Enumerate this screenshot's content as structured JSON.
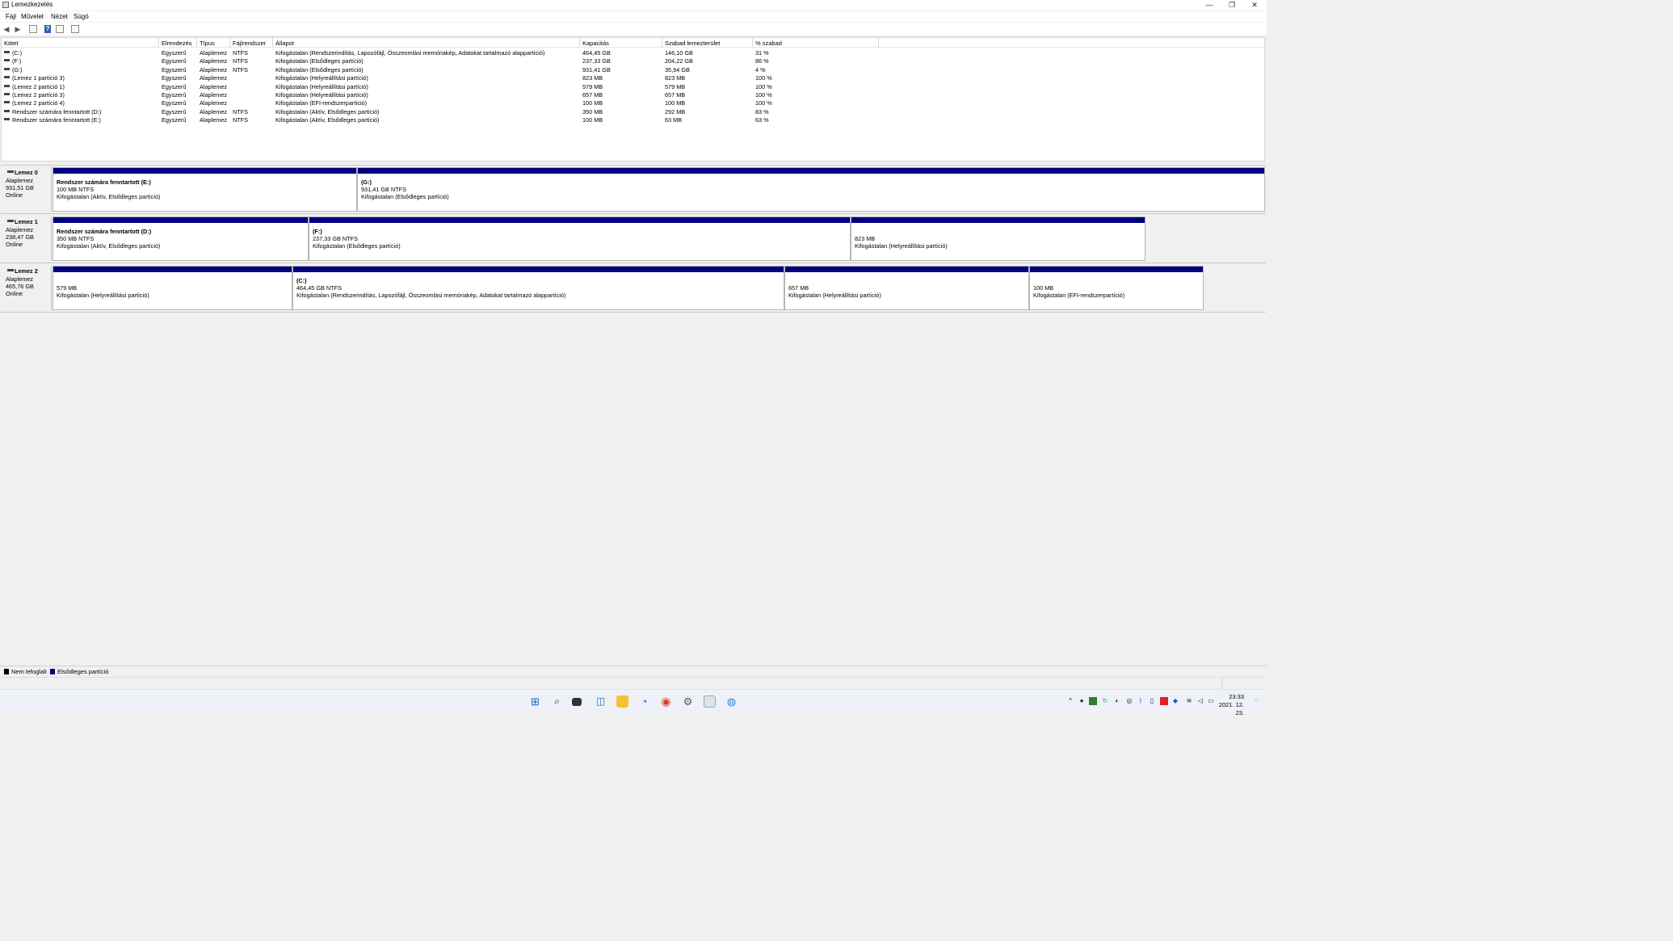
{
  "window": {
    "title": "Lemezkezelés",
    "controls": {
      "minimize": "—",
      "restore": "❐",
      "close": "✕"
    }
  },
  "menu": [
    "Fájl",
    "Művelet",
    "Nézet",
    "Súgó"
  ],
  "volume_table": {
    "headers": [
      "Kötet",
      "Elrendezés",
      "Típus",
      "Fájlrendszer",
      "Állapot",
      "Kapacitás",
      "Szabad lemezterület",
      "% szabad"
    ],
    "rows": [
      [
        "(C:)",
        "Egyszerű",
        "Alaplemez",
        "NTFS",
        "Kifogástalan (Rendszerindítás, Lapozófájl, Összeomlási memóriakép, Adatokat tartalmazó alappartíció)",
        "464,45 GB",
        "146,10 GB",
        "31 %"
      ],
      [
        "(F:)",
        "Egyszerű",
        "Alaplemez",
        "NTFS",
        "Kifogástalan (Elsődleges partíció)",
        "237,33 GB",
        "204,22 GB",
        "86 %"
      ],
      [
        "(G:)",
        "Egyszerű",
        "Alaplemez",
        "NTFS",
        "Kifogástalan (Elsődleges partíció)",
        "931,41 GB",
        "35,94 GB",
        "4 %"
      ],
      [
        "(Lemez 1 partíció 3)",
        "Egyszerű",
        "Alaplemez",
        "",
        "Kifogástalan (Helyreállítási partíció)",
        "823 MB",
        "823 MB",
        "100 %"
      ],
      [
        "(Lemez 2 partíció 1)",
        "Egyszerű",
        "Alaplemez",
        "",
        "Kifogástalan (Helyreállítási partíció)",
        "579 MB",
        "579 MB",
        "100 %"
      ],
      [
        "(Lemez 2 partíció 3)",
        "Egyszerű",
        "Alaplemez",
        "",
        "Kifogástalan (Helyreállítási partíció)",
        "657 MB",
        "657 MB",
        "100 %"
      ],
      [
        "(Lemez 2 partíció 4)",
        "Egyszerű",
        "Alaplemez",
        "",
        "Kifogástalan (EFI-rendszerpartíció)",
        "100 MB",
        "100 MB",
        "100 %"
      ],
      [
        "Rendszer számára fenntartott (D:)",
        "Egyszerű",
        "Alaplemez",
        "NTFS",
        "Kifogástalan (Aktív, Elsődleges partíció)",
        "350 MB",
        "292 MB",
        "83 %"
      ],
      [
        "Rendszer számára fenntartott (E:)",
        "Egyszerű",
        "Alaplemez",
        "NTFS",
        "Kifogástalan (Aktív, Elsődleges partíció)",
        "100 MB",
        "63 MB",
        "63 %"
      ]
    ]
  },
  "disks": [
    {
      "name": "Lemez 0",
      "type": "Alaplemez",
      "size": "931,51 GB",
      "status": "Online",
      "partitions": [
        {
          "name": "Rendszer számára fenntartott  (E:)",
          "size": "100 MB NTFS",
          "status": "Kifogástalan (Aktív, Elsődleges partíció)"
        },
        {
          "name": "(G:)",
          "size": "931,41 GB NTFS",
          "status": "Kifogástalan (Elsődleges partíció)"
        }
      ]
    },
    {
      "name": "Lemez 1",
      "type": "Alaplemez",
      "size": "238,47 GB",
      "status": "Online",
      "partitions": [
        {
          "name": "Rendszer számára fenntartott  (D:)",
          "size": "350 MB NTFS",
          "status": "Kifogástalan (Aktív, Elsődleges partíció)"
        },
        {
          "name": "(F:)",
          "size": "237,33 GB NTFS",
          "status": "Kifogástalan (Elsődleges partíció)"
        },
        {
          "name": "",
          "size": "823 MB",
          "status": "Kifogástalan (Helyreállítási partíció)"
        }
      ]
    },
    {
      "name": "Lemez 2",
      "type": "Alaplemez",
      "size": "465,76 GB",
      "status": "Online",
      "partitions": [
        {
          "name": "",
          "size": "579 MB",
          "status": "Kifogástalan (Helyreállítási partíció)"
        },
        {
          "name": "(C:)",
          "size": "464,45 GB NTFS",
          "status": "Kifogástalan (Rendszerindítás, Lapozófájl, Összeomlási memóriakép, Adatokat tartalmazó alappartíció)"
        },
        {
          "name": "",
          "size": "657 MB",
          "status": "Kifogástalan (Helyreállítási partíció)"
        },
        {
          "name": "",
          "size": "100 MB",
          "status": "Kifogástalan (EFI-rendszerpartíció)"
        }
      ]
    }
  ],
  "legend": {
    "unallocated": {
      "label": "Nem lefoglalt",
      "color": "#000000"
    },
    "primary": {
      "label": "Elsődleges partíció",
      "color": "#000080"
    }
  },
  "taskbar": {
    "apps": [
      "windows-start-icon",
      "search-icon",
      "task-view-icon",
      "widgets-icon",
      "file-explorer-icon",
      "github-desktop-icon",
      "chrome-icon",
      "settings-icon",
      "disk-management-icon",
      "network-icon"
    ],
    "tray": [
      "chevron-up-icon",
      "steam-icon",
      "nvidia-icon",
      "sync-icon",
      "app-icon",
      "obs-icon",
      "bluetooth-icon",
      "usb-icon",
      "dropbox-icon",
      "battery-icon",
      "antivirus-icon",
      "wifi-icon",
      "volume-icon"
    ],
    "time": "23:33",
    "date": "2021. 12. 23."
  }
}
